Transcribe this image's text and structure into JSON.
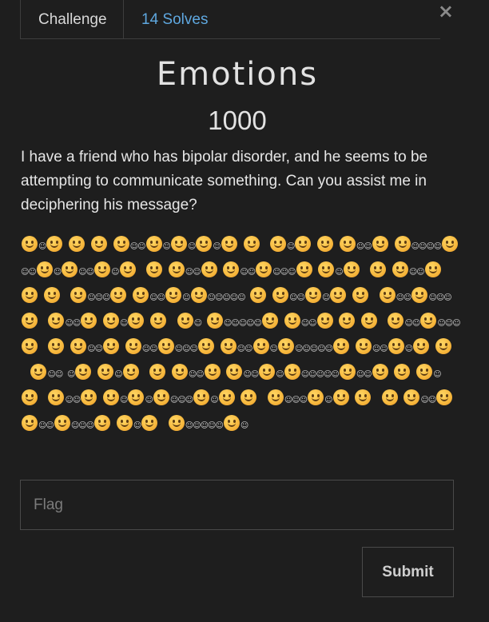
{
  "close_label": "×",
  "tabs": {
    "challenge": "Challenge",
    "solves": "14 Solves"
  },
  "challenge": {
    "name": "Emotions",
    "points": "1000",
    "description": "I have a friend who has bipolar disorder, and he seems to be attempting to communicate something. Can you assist me in deciphering his message?",
    "message_encoding": "emoji faces separated by small face glyphs"
  },
  "message_lines": [
    [
      1,
      "s",
      1,
      0,
      1,
      0,
      1,
      0,
      1,
      "ss",
      1,
      "s",
      1,
      "s",
      1,
      "s",
      1,
      0,
      1,
      "  ",
      1,
      "s",
      1,
      0,
      1,
      0,
      1,
      "ss",
      1
    ],
    [
      1,
      "ssss",
      1,
      "ss",
      1,
      "s",
      1,
      "ss",
      1,
      "s",
      1,
      "  ",
      1,
      0,
      1,
      "ss",
      1,
      0,
      1,
      "ss",
      1,
      "sss",
      1
    ],
    [
      1,
      "s",
      1,
      "  ",
      1,
      0,
      1,
      "ss",
      1,
      0,
      1,
      0,
      1,
      "  ",
      1,
      "sss",
      1,
      0,
      1,
      "ss",
      1,
      "s",
      1,
      "sssss"
    ],
    [
      1,
      0,
      1,
      "ss",
      1,
      "s",
      1,
      0,
      1,
      "  ",
      1,
      "ss",
      1,
      "sss",
      1,
      "  ",
      1,
      "ss",
      1,
      0,
      1,
      "s",
      1,
      0,
      1,
      "  ",
      1,
      "s"
    ],
    [
      1,
      "sssss",
      1,
      0,
      1,
      "ss",
      1,
      0,
      1,
      0,
      1,
      "  ",
      1,
      "ss",
      1,
      "sss",
      1,
      "  ",
      1,
      0,
      1,
      "ss",
      1
    ],
    [
      1,
      "ss",
      1,
      "sss",
      1,
      0,
      1,
      "ss",
      1,
      "s",
      1,
      "sssss",
      1,
      0,
      1,
      "ss",
      1,
      "s",
      1,
      0,
      1,
      "  ",
      1,
      "ss"
    ],
    [
      "s",
      1,
      0,
      1,
      "s",
      1,
      "  ",
      1,
      0,
      1,
      "ss",
      1,
      0,
      1,
      "ss",
      1,
      "s",
      1,
      "sssss",
      1,
      "ss",
      1,
      0,
      1,
      0,
      1,
      "s"
    ],
    [
      1,
      "  ",
      1,
      "ss",
      1,
      0,
      1,
      "s",
      1,
      "s",
      1,
      "sss",
      1,
      "s",
      1,
      0,
      1,
      "  ",
      1,
      "sss",
      1,
      "s",
      1,
      0,
      1,
      "  ",
      1
    ],
    [
      1,
      "ss",
      1,
      0,
      1,
      "ss",
      1,
      "sss",
      1,
      0,
      1,
      "s",
      1,
      "  ",
      1,
      "sssss",
      1,
      "s"
    ]
  ]
}
